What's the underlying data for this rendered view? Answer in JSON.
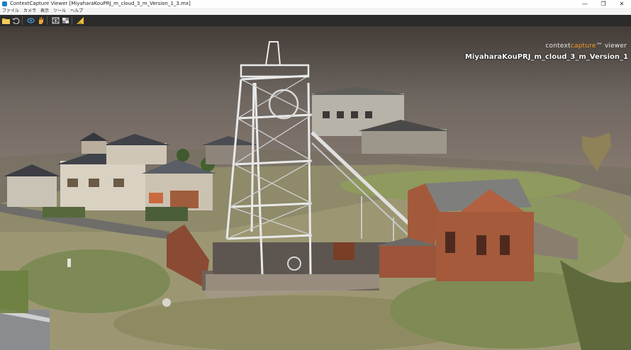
{
  "titlebar": {
    "title": "ContextCapture Viewer [MiyaharaKouPRJ_m_cloud_3_m_Version_1_3.mx]",
    "minimize": "—",
    "restore": "❐",
    "close": "✕"
  },
  "menu": {
    "items": [
      "ファイル",
      "カメラ",
      "表示",
      "ツール",
      "ヘルプ"
    ]
  },
  "toolbar": {
    "buttons": [
      "open-folder-icon",
      "undo-icon",
      "orbit-icon",
      "pan-hand-icon",
      "wireframe-icon",
      "texture-icon",
      "measure-icon"
    ]
  },
  "brand": {
    "prefix": "context",
    "accent": "capture",
    "suffix": "™ viewer",
    "accent_color": "#f39c1f"
  },
  "model": {
    "name": "MiyaharaKouPRJ_m_cloud_3_m_Version_1"
  }
}
